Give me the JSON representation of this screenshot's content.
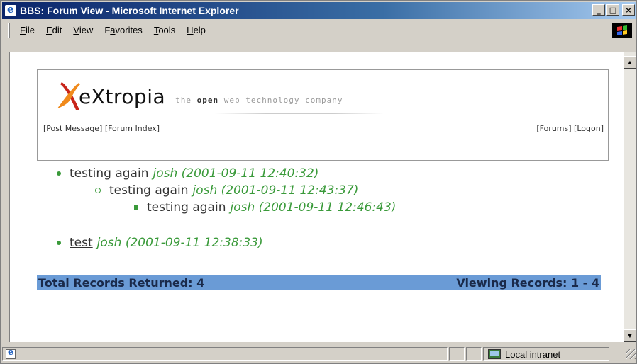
{
  "window": {
    "title": "BBS: Forum View - Microsoft Internet Explorer",
    "caption_buttons": {
      "minimize": "_",
      "maximize": "□",
      "close": "×"
    }
  },
  "menubar": {
    "items": [
      {
        "label_pre": "",
        "label_key": "F",
        "label_post": "ile"
      },
      {
        "label_pre": "",
        "label_key": "E",
        "label_post": "dit"
      },
      {
        "label_pre": "",
        "label_key": "V",
        "label_post": "iew"
      },
      {
        "label_pre": "F",
        "label_key": "a",
        "label_post": "vorites"
      },
      {
        "label_pre": "",
        "label_key": "T",
        "label_post": "ools"
      },
      {
        "label_pre": "",
        "label_key": "H",
        "label_post": "elp"
      }
    ]
  },
  "header": {
    "logo_word": "eXtropia",
    "tagline_pre": "the ",
    "tagline_bold": "open",
    "tagline_post": " web technology company",
    "brand_colors": {
      "x_orange": "#f08a1c",
      "x_red": "#c8241a"
    }
  },
  "nav": {
    "left": [
      {
        "label": "Post Message"
      },
      {
        "label": "Forum Index"
      }
    ],
    "right": [
      {
        "label": "Forums"
      },
      {
        "label": "Logon"
      }
    ]
  },
  "posts": [
    {
      "level": 0,
      "bullet": "disc",
      "subject": "testing again",
      "meta": "josh (2001-09-11 12:40:32)"
    },
    {
      "level": 1,
      "bullet": "circle",
      "subject": "testing again",
      "meta": "josh (2001-09-11 12:43:37)"
    },
    {
      "level": 2,
      "bullet": "square",
      "subject": "testing again",
      "meta": "josh (2001-09-11 12:46:43)"
    },
    {
      "level": 0,
      "bullet": "disc",
      "subject": "test",
      "meta": "josh (2001-09-11 12:38:33)"
    }
  ],
  "summary": {
    "total": "Total Records Returned: 4",
    "viewing": "Viewing Records: 1 - 4"
  },
  "statusbar": {
    "zone": "Local intranet"
  },
  "colors": {
    "meta_green": "#3a9a3a",
    "summary_bar": "#6a9bd6"
  }
}
